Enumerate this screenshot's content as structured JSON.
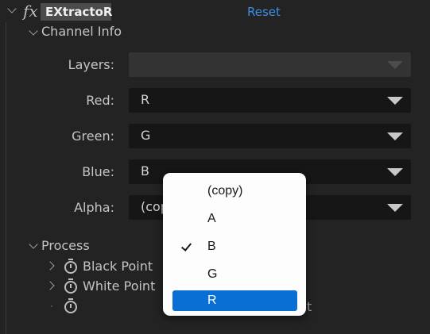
{
  "header": {
    "fx_label": "fx",
    "effect_name": "EXtractoR",
    "reset_label": "Reset"
  },
  "channel_info": {
    "title": "Channel Info",
    "rows": [
      {
        "label": "Layers:",
        "value": ""
      },
      {
        "label": "Red:",
        "value": "R"
      },
      {
        "label": "Green:",
        "value": "G"
      },
      {
        "label": "Blue:",
        "value": "B"
      },
      {
        "label": "Alpha:",
        "value": "(cop"
      }
    ]
  },
  "process": {
    "title": "Process",
    "items": [
      {
        "label": "Black Point"
      },
      {
        "label": "White Point"
      },
      {
        "label": ""
      }
    ],
    "peek_text": "t"
  },
  "popup_menu": {
    "items": [
      {
        "label": "(copy)",
        "checked": false,
        "highlighted": false
      },
      {
        "label": "A",
        "checked": false,
        "highlighted": false
      },
      {
        "label": "B",
        "checked": true,
        "highlighted": false
      },
      {
        "label": "G",
        "checked": false,
        "highlighted": false
      },
      {
        "label": "R",
        "checked": false,
        "highlighted": true
      }
    ]
  },
  "colors": {
    "panel_bg": "#232323",
    "link_blue": "#3d8ee6",
    "menu_highlight": "#0a6fd4"
  }
}
